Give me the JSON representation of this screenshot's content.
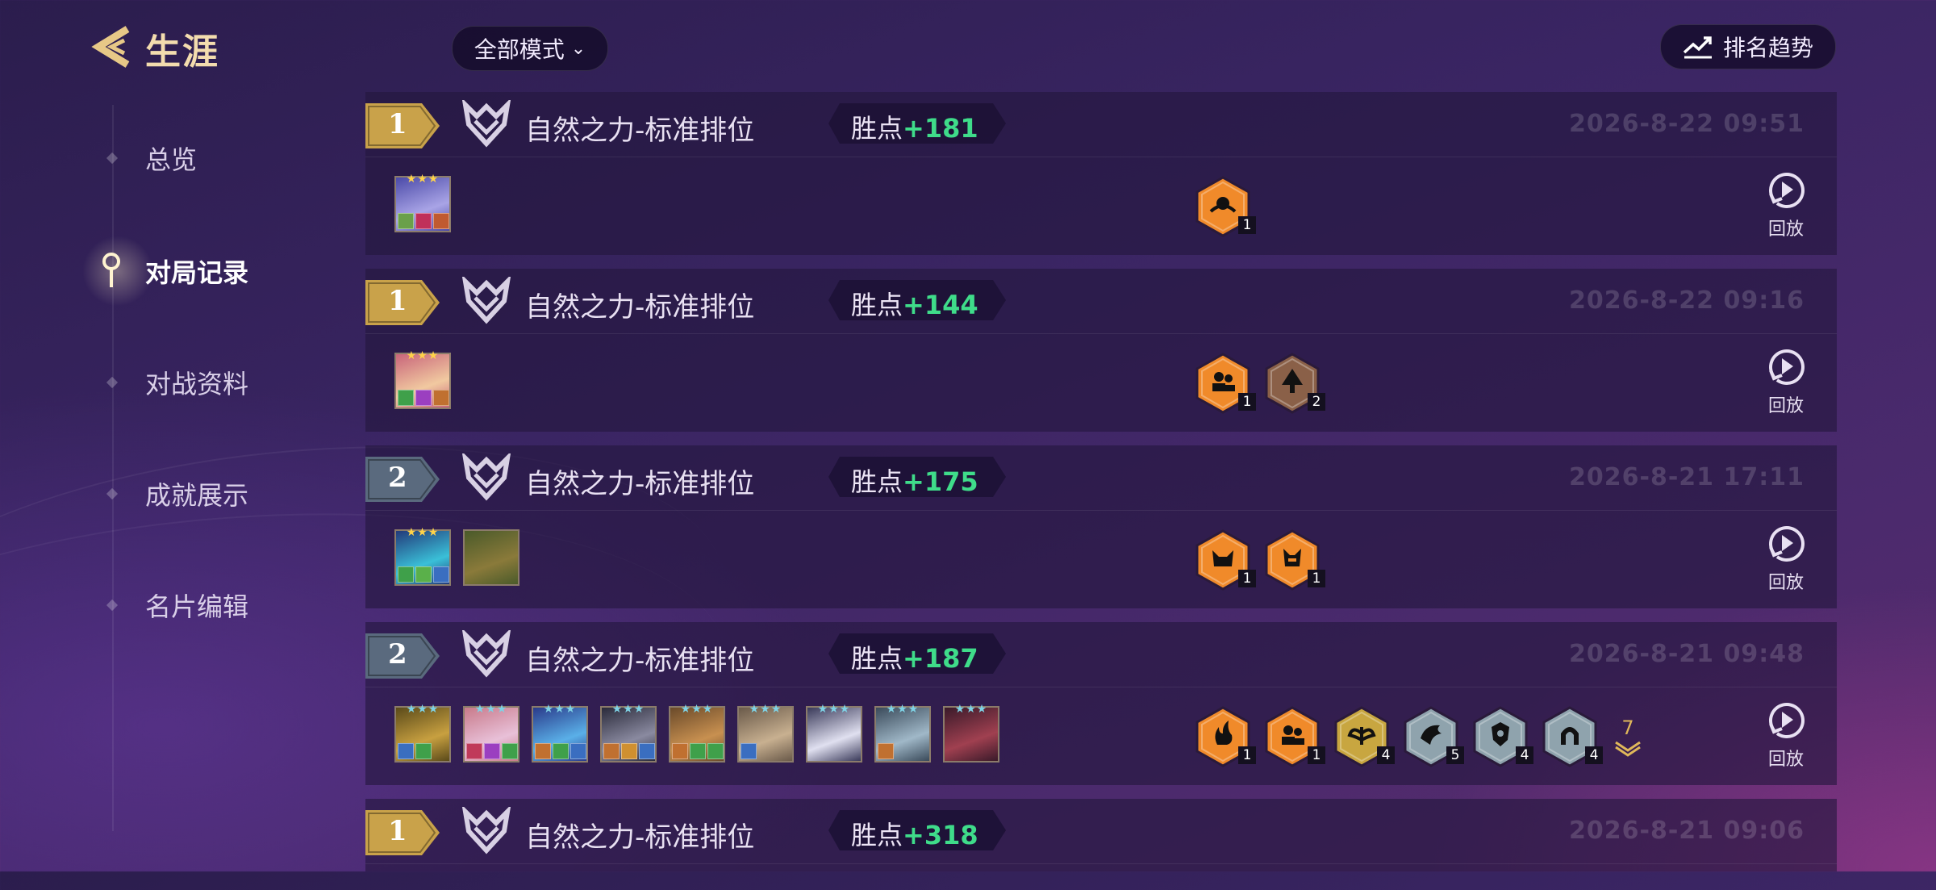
{
  "header": {
    "title": "生涯",
    "mode_filter": "全部模式",
    "trend_button": "排名趋势"
  },
  "sidebar": {
    "items": [
      {
        "label": "总览",
        "active": false
      },
      {
        "label": "对局记录",
        "active": true
      },
      {
        "label": "对战资料",
        "active": false
      },
      {
        "label": "成就展示",
        "active": false
      },
      {
        "label": "名片编辑",
        "active": false
      }
    ]
  },
  "records": [
    {
      "rank": "1",
      "rank_color": "gold",
      "mode": "自然之力-标准排位",
      "points_label": "胜点",
      "points": "+181",
      "date": "2026-8-22  09:51",
      "units": [
        {
          "stars": "★★★",
          "star_color": "#ffd34a",
          "colors": [
            "#4b4aa8",
            "#a9a4e6"
          ],
          "items": [
            "#6aa04a",
            "#c0305a",
            "#c05a30"
          ]
        }
      ],
      "traits": [
        {
          "count": "1",
          "tier": "orange",
          "icon": "sun-icon"
        }
      ],
      "more": "",
      "replay": "回放"
    },
    {
      "rank": "1",
      "rank_color": "gold",
      "mode": "自然之力-标准排位",
      "points_label": "胜点",
      "points": "+144",
      "date": "2026-8-22  09:16",
      "units": [
        {
          "stars": "★★★",
          "star_color": "#ffd34a",
          "colors": [
            "#c8647a",
            "#f1c9a0"
          ],
          "items": [
            "#3fa04a",
            "#9b3fc0",
            "#c07030"
          ]
        }
      ],
      "traits": [
        {
          "count": "1",
          "tier": "orange",
          "icon": "people-icon"
        },
        {
          "count": "2",
          "tier": "bronze",
          "icon": "tree-icon"
        }
      ],
      "more": "",
      "replay": "回放"
    },
    {
      "rank": "2",
      "rank_color": "silver",
      "mode": "自然之力-标准排位",
      "points_label": "胜点",
      "points": "+175",
      "date": "2026-8-21  17:11",
      "units": [
        {
          "stars": "★★★",
          "star_color": "#ffd34a",
          "colors": [
            "#233a7a",
            "#3ac0d8"
          ],
          "items": [
            "#3fa04a",
            "#5ab04a",
            "#3a6ec0"
          ]
        },
        {
          "stars": "",
          "star_color": "#ffd34a",
          "colors": [
            "#4a5a2a",
            "#8a7a3a"
          ],
          "items": []
        }
      ],
      "traits": [
        {
          "count": "1",
          "tier": "orange",
          "icon": "beast-icon"
        },
        {
          "count": "1",
          "tier": "orange",
          "icon": "demon-icon"
        }
      ],
      "more": "",
      "replay": "回放"
    },
    {
      "rank": "2",
      "rank_color": "silver",
      "mode": "自然之力-标准排位",
      "points_label": "胜点",
      "points": "+187",
      "date": "2026-8-21  09:48",
      "units": [
        {
          "stars": "★★★",
          "star_color": "#7fd3e6",
          "colors": [
            "#5a4a1a",
            "#c8a040"
          ],
          "items": [
            "#3a6ec0",
            "#3fa04a"
          ]
        },
        {
          "stars": "★★★",
          "star_color": "#7fd3e6",
          "colors": [
            "#c87a8a",
            "#e8c0d8"
          ],
          "items": [
            "#c03a5a",
            "#9b3fc0",
            "#3fa04a"
          ]
        },
        {
          "stars": "★★★",
          "star_color": "#7fd3e6",
          "colors": [
            "#2a3a8a",
            "#5ab0e8"
          ],
          "items": [
            "#c07030",
            "#3fa04a",
            "#3a6ec0"
          ]
        },
        {
          "stars": "★★★",
          "star_color": "#7fd3e6",
          "colors": [
            "#2a2a3a",
            "#8a8aa0"
          ],
          "items": [
            "#c07030",
            "#d09030",
            "#3a6ec0"
          ]
        },
        {
          "stars": "★★★",
          "star_color": "#7fd3e6",
          "colors": [
            "#6a4a2a",
            "#c89050"
          ],
          "items": [
            "#c07030",
            "#3fa04a",
            "#3fa04a"
          ]
        },
        {
          "stars": "★★★",
          "star_color": "#7fd3e6",
          "colors": [
            "#6a5a4a",
            "#c8b090"
          ],
          "items": [
            "#3a6ec0"
          ]
        },
        {
          "stars": "★★★",
          "star_color": "#7fd3e6",
          "colors": [
            "#3a3a5a",
            "#e0e0f0"
          ],
          "items": []
        },
        {
          "stars": "★★★",
          "star_color": "#7fd3e6",
          "colors": [
            "#3a4a5a",
            "#a0b8c8"
          ],
          "items": [
            "#c07030"
          ]
        },
        {
          "stars": "★★★",
          "star_color": "#7fd3e6",
          "colors": [
            "#3a1a2a",
            "#a04050"
          ],
          "items": []
        }
      ],
      "traits": [
        {
          "count": "1",
          "tier": "orange",
          "icon": "flame-icon"
        },
        {
          "count": "1",
          "tier": "orange",
          "icon": "people-icon"
        },
        {
          "count": "4",
          "tier": "gold",
          "icon": "wings-icon"
        },
        {
          "count": "5",
          "tier": "silver",
          "icon": "dragon-icon"
        },
        {
          "count": "4",
          "tier": "silver",
          "icon": "shield-icon"
        },
        {
          "count": "4",
          "tier": "silver",
          "icon": "arch-icon"
        }
      ],
      "more": "7",
      "replay": "回放"
    },
    {
      "rank": "1",
      "rank_color": "gold",
      "mode": "自然之力-标准排位",
      "points_label": "胜点",
      "points": "+318",
      "date": "2026-8-21  09:06",
      "units": [],
      "traits": [],
      "more": "",
      "replay": "回放"
    }
  ],
  "colors": {
    "gold": "#c9a24a",
    "silver": "#5a6a7e",
    "orange": "#f08a2a",
    "bronze": "#8a6048",
    "tier_gold": "#c8a640",
    "tier_silver": "#8fa3ad",
    "points": "#3fdc8a"
  }
}
